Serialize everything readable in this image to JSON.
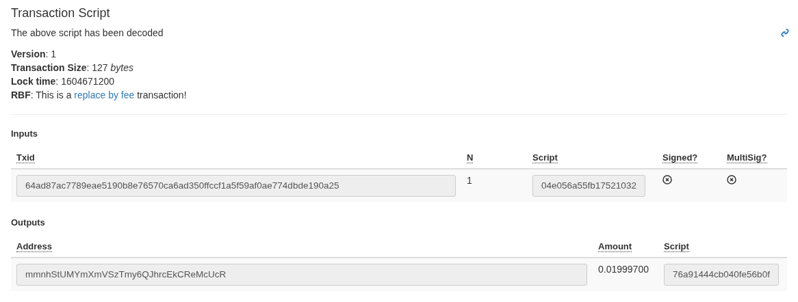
{
  "title": "Transaction Script",
  "subtitle": "The above script has been decoded",
  "details": [
    "**Version**: 1",
    "**Transaction Size**: 127 *bytes*",
    "**Lock time**: 1604671200"
  ],
  "rbf": {
    "before": "**RBF**: This is a",
    "link": "replace by fee",
    "after": "transaction!"
  },
  "inputs": {
    "heading": "Inputs",
    "columns": [
      "Txid",
      "N",
      "Script",
      "Signed?",
      "MultiSig?"
    ],
    "rows": [
      {
        "txid": "64ad87ac7789eae5190b8e76570ca6ad350ffccf1a5f59af0ae774dbde190a25",
        "n": "1",
        "script": "04e056a55fb17521032",
        "signed": false,
        "multisig": false
      }
    ]
  },
  "outputs": {
    "heading": "Outputs",
    "columns": [
      "Address",
      "Amount",
      "Script"
    ],
    "rows": [
      {
        "address": "mmnhStUMYmXmVSzTmy6QJhrcEkCReMcUcR",
        "amount": "0.01999700",
        "script": "76a91444cb040fe56b0f"
      }
    ]
  }
}
